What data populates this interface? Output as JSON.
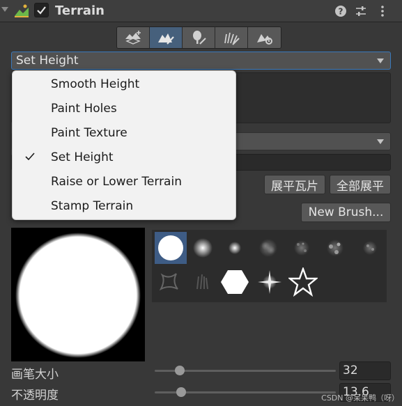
{
  "header": {
    "title": "Terrain",
    "enabled": true,
    "icons": [
      "terrain-component-icon",
      "help-icon",
      "preset-icon",
      "more-options-icon"
    ]
  },
  "toolbar": {
    "tools": [
      {
        "name": "create-neighbor-terrains-icon",
        "active": false
      },
      {
        "name": "paint-terrain-icon",
        "active": true
      },
      {
        "name": "paint-trees-icon",
        "active": false
      },
      {
        "name": "paint-details-icon",
        "active": false
      },
      {
        "name": "terrain-settings-icon",
        "active": false
      }
    ]
  },
  "tool_dropdown": {
    "selected": "Set Height"
  },
  "menu": {
    "items": [
      {
        "label": "Smooth Height",
        "checked": false
      },
      {
        "label": "Paint Holes",
        "checked": false
      },
      {
        "label": "Paint Texture",
        "checked": false
      },
      {
        "label": "Set Height",
        "checked": true
      },
      {
        "label": "Raise or Lower Terrain",
        "checked": false
      },
      {
        "label": "Stamp Terrain",
        "checked": false
      }
    ]
  },
  "buttons": {
    "flatten_tile": "展平瓦片",
    "flatten_all": "全部展平",
    "new_brush": "New Brush..."
  },
  "brushes": {
    "selected_index": 0,
    "count": 12
  },
  "sliders": {
    "brush_size": {
      "label": "画笔大小",
      "value": "32",
      "fraction": 0.14
    },
    "opacity": {
      "label": "不透明度",
      "value": "13.6",
      "fraction": 0.145
    }
  },
  "watermark": "CSDN @呆呆鸭（呀）",
  "colors": {
    "panel_bg": "#383838",
    "active_tool": "#46607c",
    "selected_brush": "#3e5c85",
    "dropdown_focus_border": "#3a79bb",
    "menu_bg": "#f2f2f2"
  }
}
